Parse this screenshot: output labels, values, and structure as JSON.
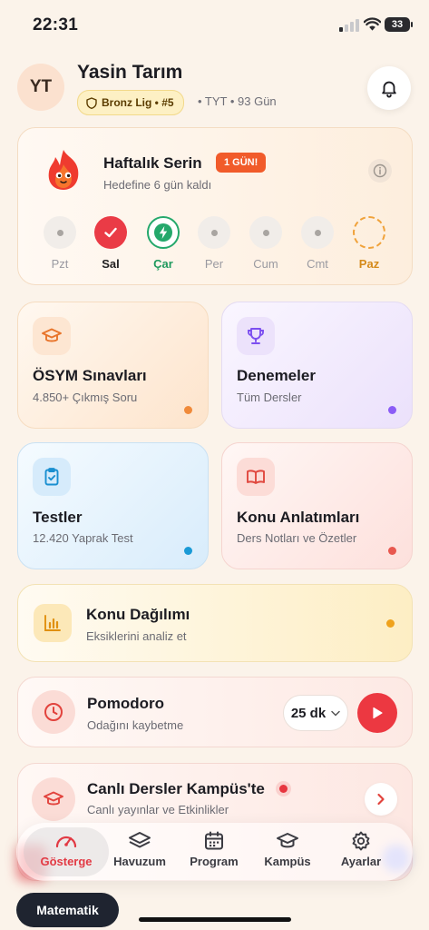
{
  "status_bar": {
    "time": "22:31",
    "battery": "33"
  },
  "header": {
    "avatar_initials": "YT",
    "user_name": "Yasin Tarım",
    "league": "Bronz Lig • #5",
    "meta": "• TYT • 93 Gün"
  },
  "streak": {
    "title": "Haftalık Serin",
    "badge": "1 GÜN!",
    "subtitle": "Hedefine 6 gün kaldı",
    "days": [
      {
        "label": "Pzt",
        "state": "idle"
      },
      {
        "label": "Sal",
        "state": "done"
      },
      {
        "label": "Çar",
        "state": "active"
      },
      {
        "label": "Per",
        "state": "idle"
      },
      {
        "label": "Cum",
        "state": "idle"
      },
      {
        "label": "Cmt",
        "state": "idle"
      },
      {
        "label": "Paz",
        "state": "goal"
      }
    ]
  },
  "cards": {
    "osym": {
      "title": "ÖSYM Sınavları",
      "subtitle": "4.850+ Çıkmış Soru",
      "color": "#f08a3a"
    },
    "denemeler": {
      "title": "Denemeler",
      "subtitle": "Tüm Dersler",
      "color": "#8b5cf6"
    },
    "testler": {
      "title": "Testler",
      "subtitle": "12.420 Yaprak Test",
      "color": "#1a9ad6"
    },
    "konu": {
      "title": "Konu Anlatımları",
      "subtitle": "Ders Notları ve Özetler",
      "color": "#e8584f"
    }
  },
  "konu_dagilimi": {
    "title": "Konu Dağılımı",
    "subtitle": "Eksiklerini analiz et"
  },
  "pomodoro": {
    "title": "Pomodoro",
    "subtitle": "Odağını kaybetme",
    "duration": "25 dk"
  },
  "canli": {
    "title": "Canlı Dersler Kampüs'te",
    "subtitle": "Canlı yayınlar ve Etkinlikler"
  },
  "nav": {
    "items": [
      {
        "label": "Gösterge",
        "icon": "gauge-icon",
        "active": true
      },
      {
        "label": "Havuzum",
        "icon": "layers-icon",
        "active": false
      },
      {
        "label": "Program",
        "icon": "calendar-icon",
        "active": false
      },
      {
        "label": "Kampüs",
        "icon": "graduation-cap-icon",
        "active": false
      },
      {
        "label": "Ayarlar",
        "icon": "gear-icon",
        "active": false
      }
    ]
  },
  "subject_chip": "Matematik",
  "colors": {
    "accent_red": "#ec3841",
    "streak_green": "#24a86b",
    "goal_orange": "#f0a23a"
  }
}
